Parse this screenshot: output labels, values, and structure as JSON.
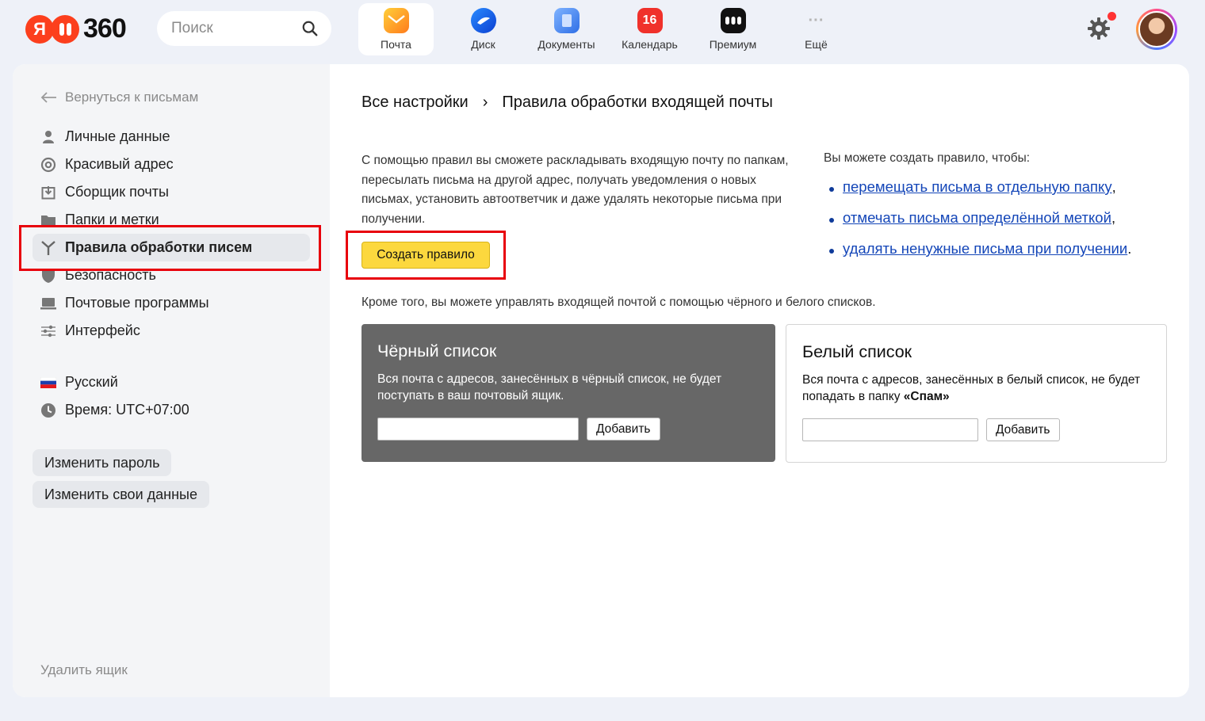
{
  "header": {
    "logo": {
      "ya": "Я",
      "brand_number": "360"
    },
    "search": {
      "placeholder": "Поиск"
    },
    "services": [
      {
        "label": "Почта",
        "icon": "mail-icon",
        "active": true,
        "color": "#ffb21c"
      },
      {
        "label": "Диск",
        "icon": "disk-icon",
        "active": false,
        "color": "#1560e0"
      },
      {
        "label": "Документы",
        "icon": "documents-icon",
        "active": false,
        "color": "#3b82ee"
      },
      {
        "label": "Календарь",
        "icon": "calendar-icon",
        "badge": "16",
        "active": false,
        "color": "#f0312b"
      },
      {
        "label": "Премиум",
        "icon": "premium-icon",
        "active": false,
        "color": "#111111"
      },
      {
        "label": "Ещё",
        "icon": "more-icon",
        "active": false,
        "color": "#b5b5b5"
      }
    ],
    "settings_icon": "gear-icon",
    "notification_color": "#ff3333"
  },
  "sidebar": {
    "back_label": "Вернуться к письмам",
    "items": [
      {
        "label": "Личные данные",
        "icon": "person-icon"
      },
      {
        "label": "Красивый адрес",
        "icon": "at-icon"
      },
      {
        "label": "Сборщик почты",
        "icon": "inbox-download-icon"
      },
      {
        "label": "Папки и метки",
        "icon": "folder-icon"
      },
      {
        "label": "Правила обработки писем",
        "icon": "rules-icon",
        "active": true
      },
      {
        "label": "Безопасность",
        "icon": "shield-icon"
      },
      {
        "label": "Почтовые программы",
        "icon": "laptop-icon"
      },
      {
        "label": "Интерфейс",
        "icon": "sliders-icon"
      }
    ],
    "language": {
      "label": "Русский",
      "icon": "flag-ru-icon"
    },
    "timezone": {
      "label": "Время: UTC+07:00",
      "icon": "clock-icon"
    },
    "change_password_label": "Изменить пароль",
    "change_data_label": "Изменить свои данные",
    "delete_box_label": "Удалить ящик"
  },
  "main": {
    "breadcrumb": {
      "root": "Все настройки",
      "separator": "›",
      "current": "Правила обработки входящей почты"
    },
    "description": "С помощью правил вы сможете раскладывать входящую почту по папкам, пересылать письма на другой адрес, получать уведомления о новых письмах, установить автоответчик и даже удалять некоторые письма при получении.",
    "create_rule_label": "Создать правило",
    "can_title": "Вы можете создать правило, чтобы:",
    "can_items": [
      {
        "link": "перемещать письма в отдельную папку",
        "suffix": ","
      },
      {
        "link": "отмечать письма определённой меткой",
        "suffix": ","
      },
      {
        "link": "удалять ненужные письма при получении",
        "suffix": "."
      }
    ],
    "also_text": "Кроме того, вы можете управлять входящей почтой с помощью чёрного и белого списков.",
    "blacklist": {
      "title": "Чёрный список",
      "description": "Вся почта с адресов, занесённых в чёрный список, не будет поступать в ваш почтовый ящик.",
      "input_value": "",
      "add_label": "Добавить"
    },
    "whitelist": {
      "title": "Белый список",
      "description_prefix": "Вся почта с адресов, занесённых в белый список, не будет попадать в папку ",
      "description_bold": "«Спам»",
      "input_value": "",
      "add_label": "Добавить"
    }
  },
  "colors": {
    "accent_yellow": "#fcd83e",
    "link_blue": "#1446b8",
    "highlight_red": "#e8000b",
    "blacklist_bg": "#676767"
  }
}
